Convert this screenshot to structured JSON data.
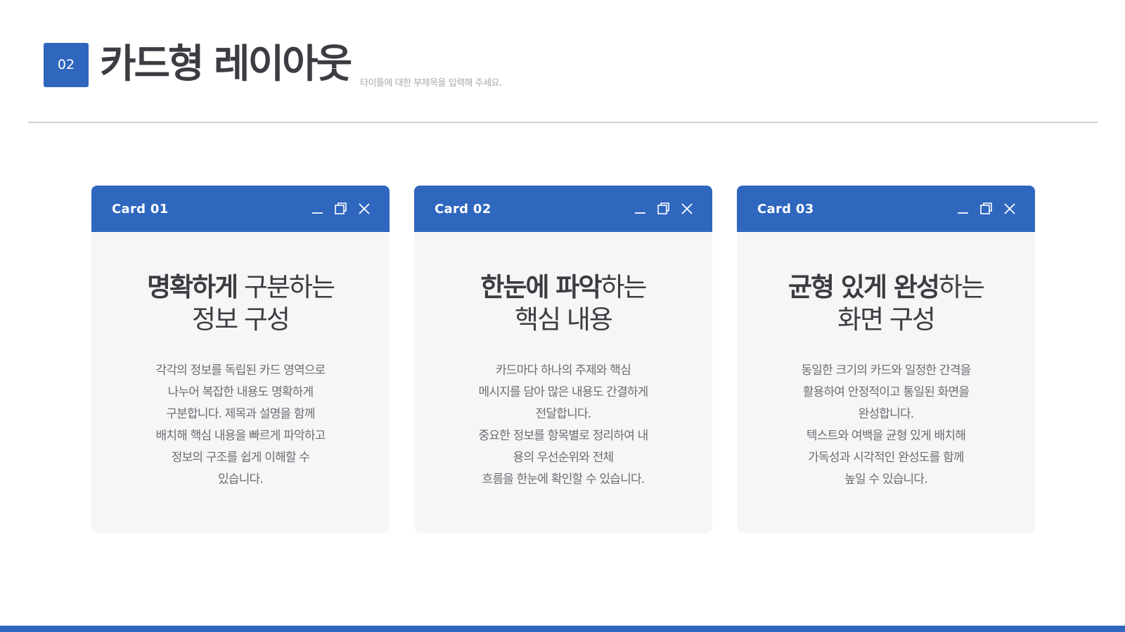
{
  "header": {
    "badge": "02",
    "title": "카드형 레이아웃",
    "subtitle": "타이틀에 대한 부제목을 입력해 주세요."
  },
  "cards": [
    {
      "name": "Card 01",
      "title_bold": "명확하게",
      "title_rest": " 구분하는",
      "title_line2": "정보 구성",
      "body": [
        "각각의 정보를 독립된 카드 영역으로",
        "나누어 복잡한 내용도 명확하게",
        "구분합니다. 제목과 설명을 함께",
        "배치해 핵심 내용을 빠르게 파악하고",
        "정보의 구조를 쉽게 이해할 수",
        "있습니다."
      ]
    },
    {
      "name": "Card 02",
      "title_bold": "한눈에 파악",
      "title_rest": "하는",
      "title_line2": "핵심 내용",
      "body": [
        "카드마다 하나의 주제와 핵심",
        "메시지를 담아 많은 내용도 간결하게",
        "전달합니다.",
        "중요한 정보를 항목별로 정리하여 내",
        "용의 우선순위와 전체",
        "흐름을 한눈에 확인할 수 있습니다."
      ]
    },
    {
      "name": "Card 03",
      "title_bold": "균형 있게 완성",
      "title_rest": "하는",
      "title_line2": "화면 구성",
      "body": [
        "동일한 크기의 카드와 일정한 간격을",
        "활용하여 안정적이고 통일된 화면을",
        "완성합니다.",
        "텍스트와 여백을 균형 있게 배치해",
        "가독성과 시각적인 완성도를 함께",
        "높일 수 있습니다."
      ]
    }
  ],
  "window_icons": [
    "minimize-icon",
    "restore-icon",
    "close-icon"
  ],
  "colors": {
    "accent": "#2f67bf",
    "card_bg": "#f6f6f7",
    "title_text": "#3c3d42",
    "body_text": "#6a6c71"
  }
}
